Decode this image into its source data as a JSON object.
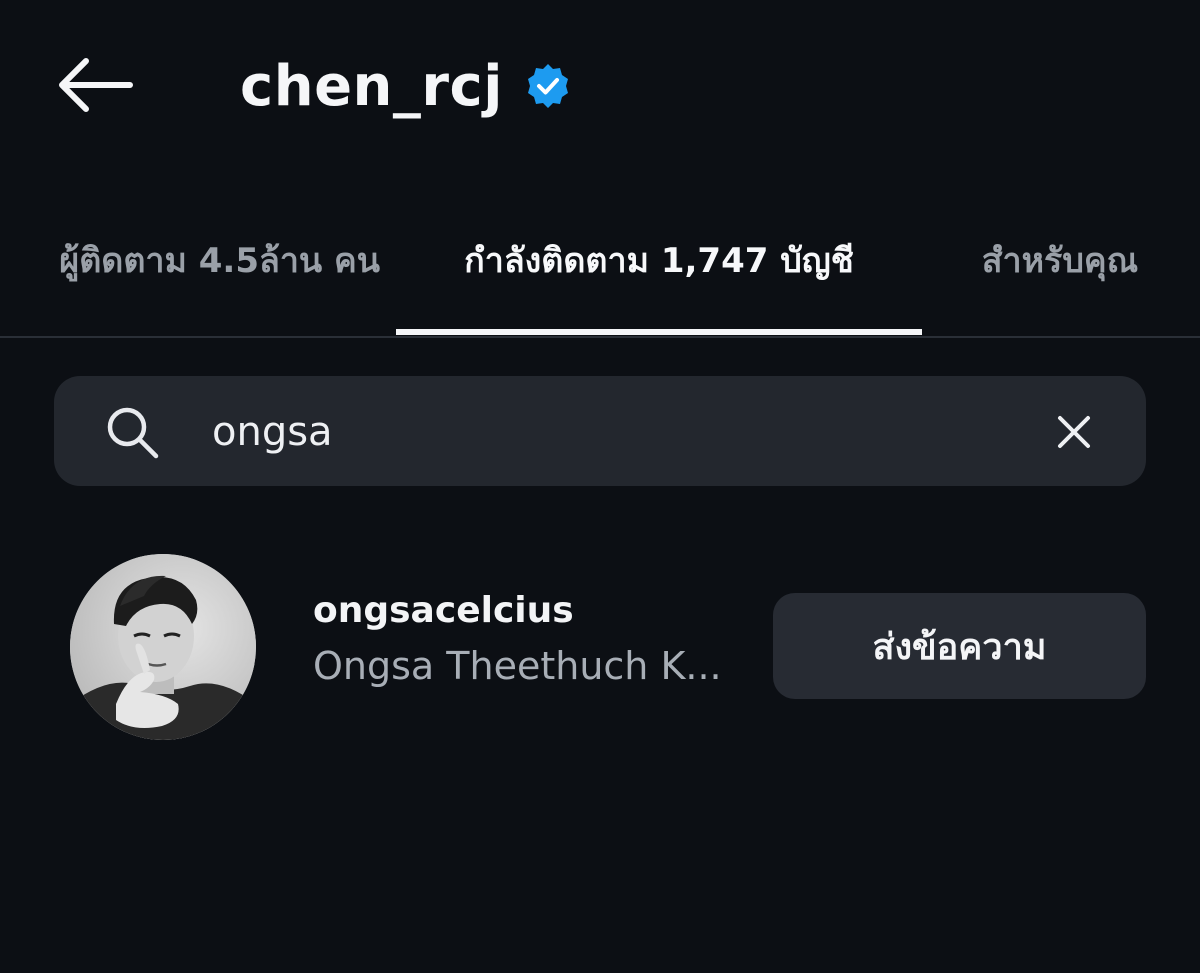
{
  "header": {
    "back_icon": "arrow-left-icon",
    "username": "chen_rcj",
    "verified_icon": "verified-badge-icon",
    "verified_color": "#1d9bf0"
  },
  "tabs": [
    {
      "label": "ผู้ติดตาม 4.5ล้าน คน",
      "active": false
    },
    {
      "label": "กำลังติดตาม 1,747 บัญชี",
      "active": true
    },
    {
      "label": "สำหรับคุณ",
      "active": false
    }
  ],
  "search": {
    "icon": "search-icon",
    "value": "ongsa",
    "clear_icon": "close-icon"
  },
  "results": [
    {
      "avatar": "profile-photo",
      "handle": "ongsacelcius",
      "name": "Ongsa Theethuch K...",
      "button_label": "ส่งข้อความ"
    }
  ]
}
